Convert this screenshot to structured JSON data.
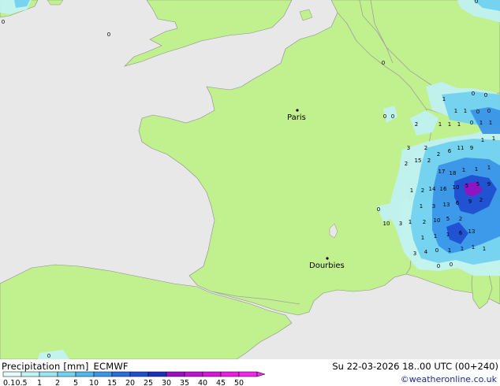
{
  "map": {
    "cities": [
      {
        "name": "Paris",
        "id": "paris"
      },
      {
        "name": "Dourbies",
        "id": "dourbies"
      }
    ],
    "precip_values": [
      "1",
      "1",
      "1",
      "0",
      "0",
      "0",
      "0",
      "0",
      "1",
      "1",
      "1",
      "1",
      "1",
      "2",
      "3",
      "2",
      "2",
      "6",
      "11",
      "9",
      "1",
      "1",
      "2",
      "15",
      "2",
      "17",
      "18",
      "1",
      "1",
      "1",
      "1",
      "2",
      "14",
      "16",
      "10",
      "5",
      "5",
      "9",
      "1",
      "3",
      "13",
      "6",
      "9",
      "2",
      "1",
      "2",
      "10",
      "5",
      "2",
      "10",
      "3",
      "1",
      "1",
      "1",
      "6",
      "13",
      "3",
      "4",
      "0",
      "1",
      "1",
      "1",
      "1",
      "0",
      "0",
      "0",
      "0",
      "0",
      "0",
      "0",
      "0",
      "0",
      "0"
    ]
  },
  "legend": {
    "title": "Precipitation [mm]",
    "model": "ECMWF",
    "scale_labels": [
      "0.1",
      "0.5",
      "1",
      "2",
      "5",
      "10",
      "15",
      "20",
      "25",
      "30",
      "35",
      "40",
      "45",
      "50"
    ],
    "scale_colors": [
      "#e6fbfb",
      "#c2f2f2",
      "#9be6f0",
      "#73d2f0",
      "#4fb8ec",
      "#3a96e8",
      "#2a6fdc",
      "#1f4fd0",
      "#1a30b8",
      "#9a10c0",
      "#c012d0",
      "#d818d8",
      "#e81ee0",
      "#f028e8"
    ]
  },
  "timestamp": "Su 22-03-2026 18..00 UTC (00+240)",
  "credit": "©weatheronline.co.uk",
  "colors": {
    "land": "#c1f18e",
    "sea": "#e8e8e8",
    "border": "#a0a0a0",
    "coast": "#8c8c8c"
  }
}
